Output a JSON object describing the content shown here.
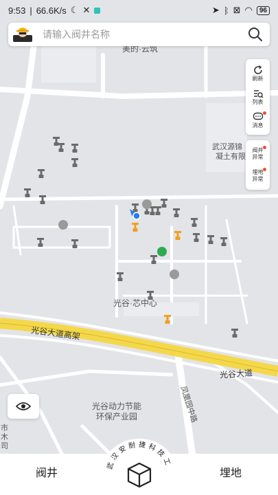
{
  "status_bar": {
    "time": "9:53",
    "network_speed": "66.6K/s",
    "battery": "96"
  },
  "search": {
    "placeholder": "请输入阀井名称"
  },
  "tools": [
    {
      "label": "刷新",
      "icon": "refresh-icon"
    },
    {
      "label": "列表",
      "icon": "list-search-icon"
    },
    {
      "label": "消息",
      "icon": "message-icon"
    }
  ],
  "alerts": [
    {
      "label": "阀井\n异常",
      "line1": "阀井",
      "line2": "异常"
    },
    {
      "label": "埋地\n异常",
      "line1": "埋地",
      "line2": "异常"
    }
  ],
  "map_labels": {
    "top_place": "美的·云筑",
    "company": "武汉源锦",
    "company2": "凝土有限",
    "center": "光谷·芯中心",
    "highway": "光谷大道高架",
    "road": "光谷大道",
    "park1": "光谷动力节能",
    "park2": "环保产业园",
    "road_vertical": "凤凰园中路",
    "edge1": "市",
    "edge2": "木",
    "edge3": "司"
  },
  "bottom_nav": {
    "left_tab": "阀井",
    "right_tab": "埋地",
    "center_ring_text": "武汉安耐捷科技工程",
    "center_icon": "box-icon"
  },
  "colors": {
    "valve_gray": "#6b6b6b",
    "valve_orange": "#f0a020",
    "marker_green": "#2eaa50",
    "location_blue": "#2b7bf0",
    "highway_yellow": "#f4d84a",
    "alert_dot": "#f05030"
  }
}
